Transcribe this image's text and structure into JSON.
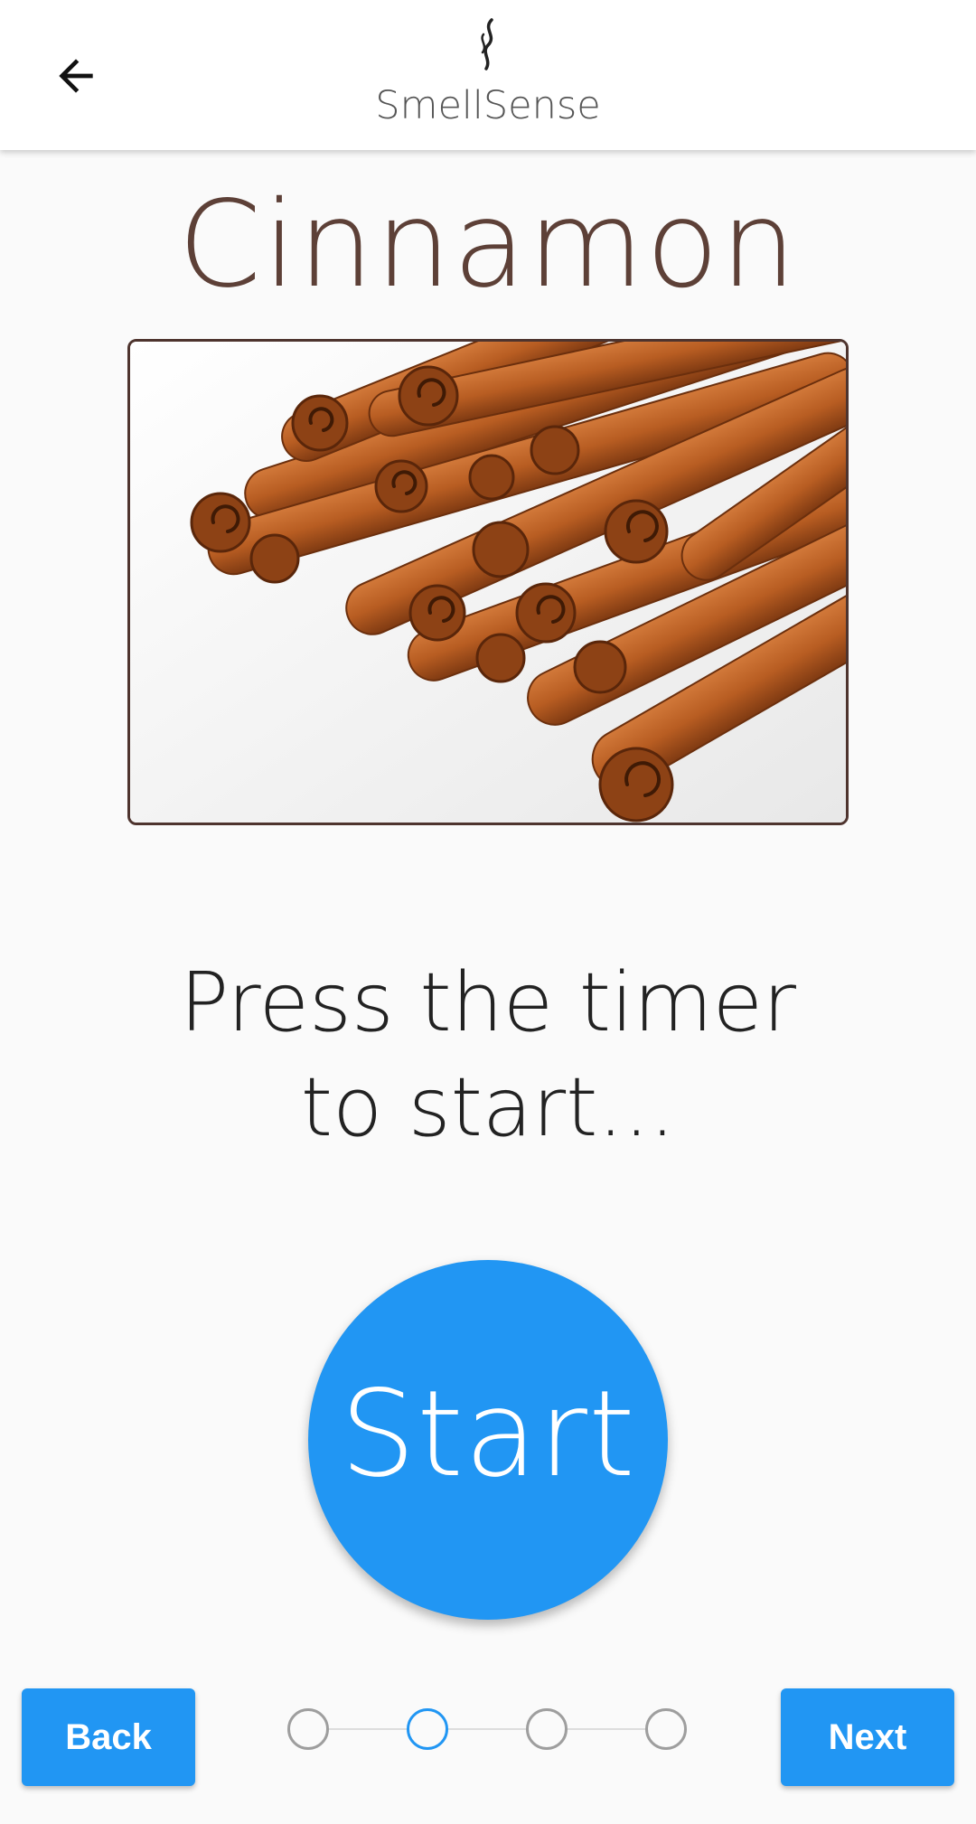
{
  "header": {
    "app_name": "SmellSense",
    "back_icon": "arrow-left-icon",
    "logo_icon": "smoke-wisp-icon"
  },
  "scent": {
    "title": "Cinnamon",
    "image_icon": "cinnamon-sticks-image"
  },
  "prompt": {
    "line1": "Press the timer",
    "line2": "to start..."
  },
  "timer": {
    "start_label": "Start"
  },
  "footer": {
    "back_label": "Back",
    "next_label": "Next",
    "steps_total": 4,
    "active_step": 2
  },
  "colors": {
    "accent": "#2196f3",
    "title_brown": "#5d4037",
    "frame_border": "#4e342e"
  }
}
